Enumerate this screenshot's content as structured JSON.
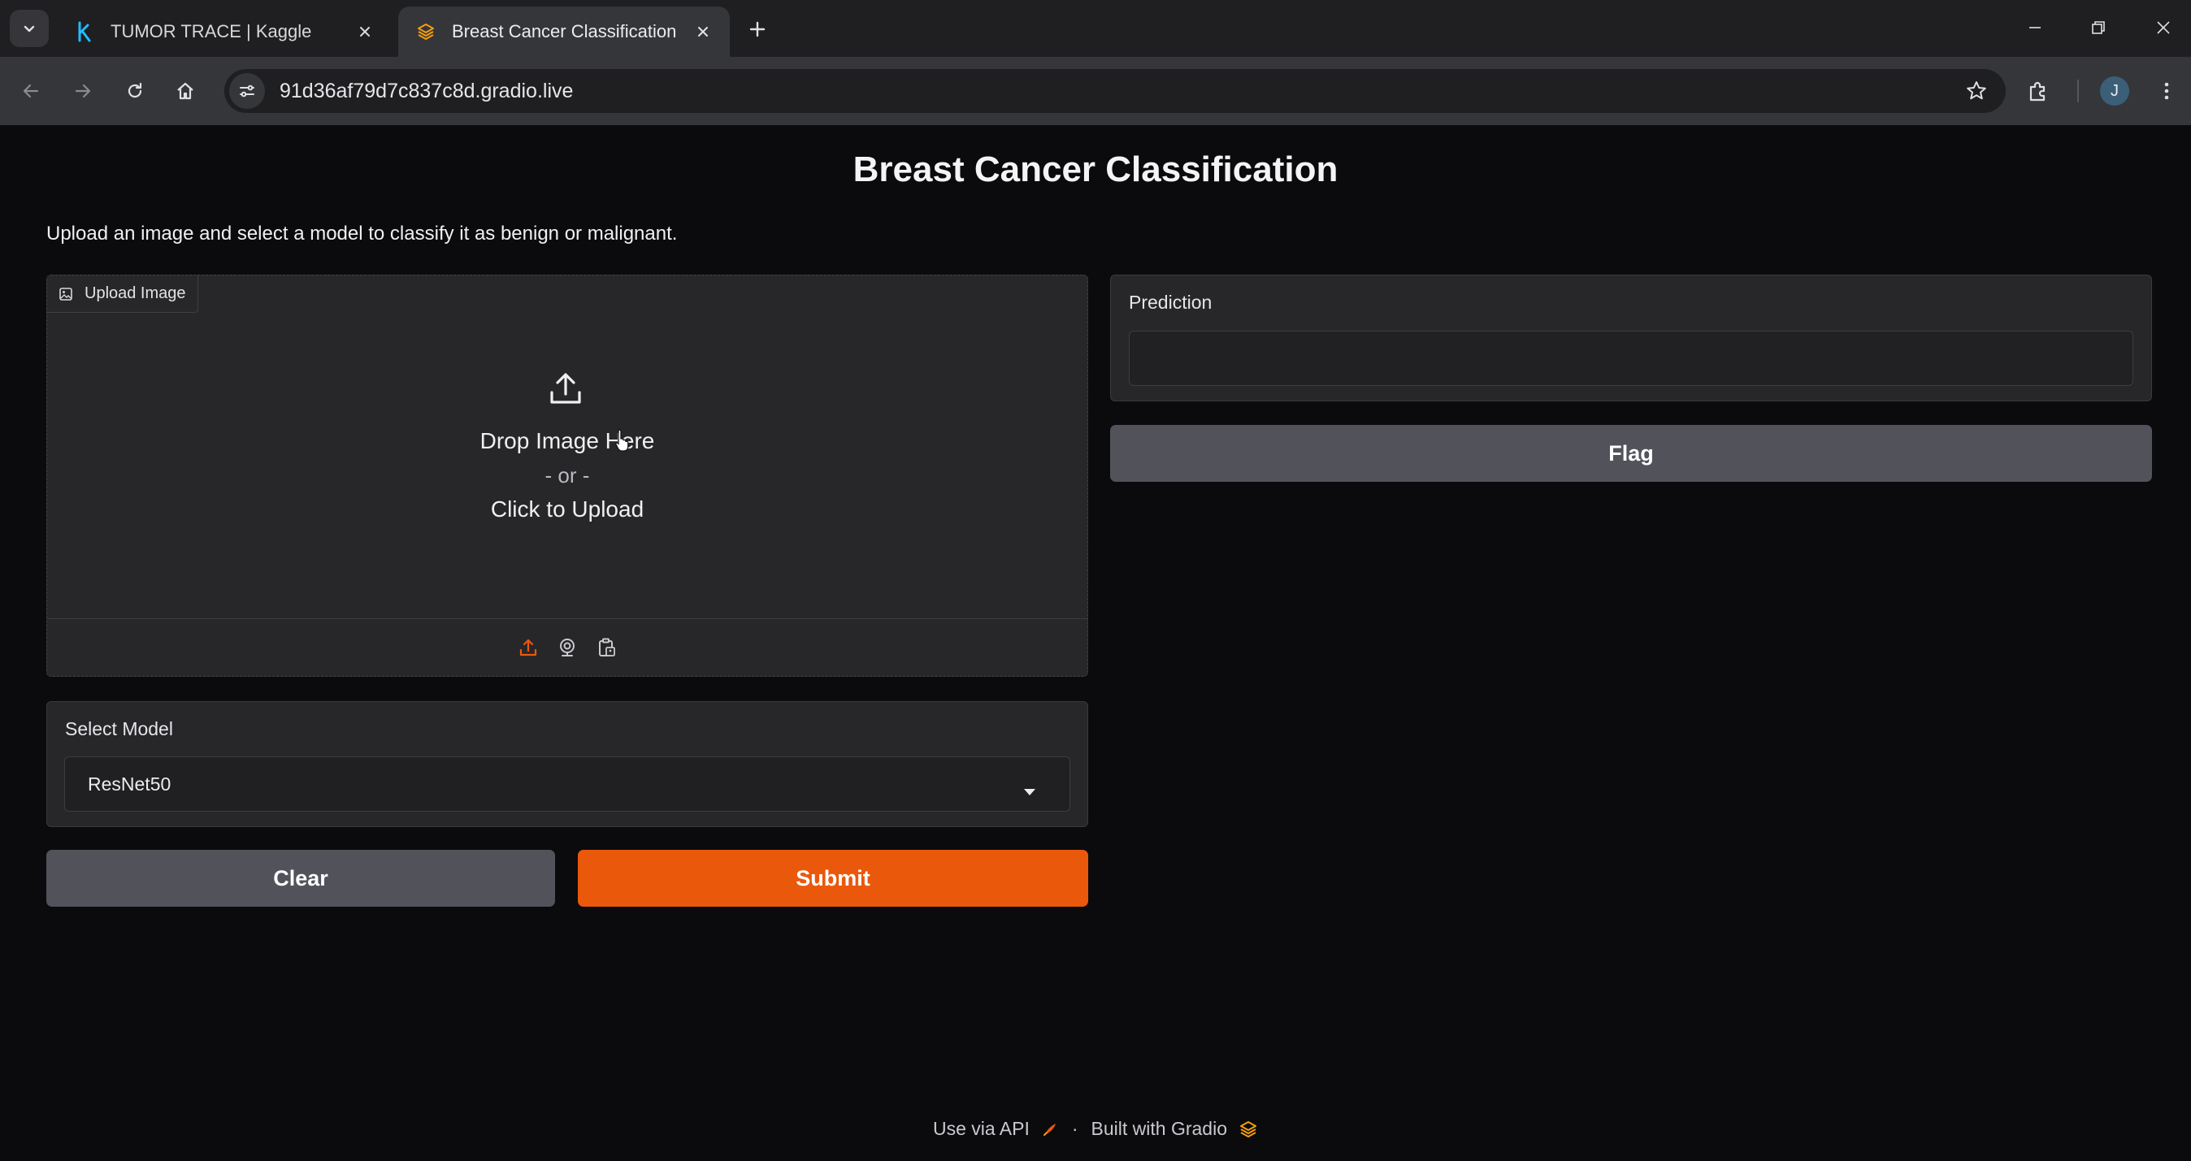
{
  "browser": {
    "tabs": [
      {
        "title": "TUMOR TRACE | Kaggle",
        "favicon": "kaggle-k-icon",
        "active": false
      },
      {
        "title": "Breast Cancer Classification",
        "favicon": "gradio-icon",
        "active": true
      }
    ],
    "url": "91d36af79d7c837c8d.gradio.live",
    "profile_initial": "J"
  },
  "app": {
    "title": "Breast Cancer Classification",
    "description": "Upload an image and select a model to classify it as benign or malignant.",
    "upload": {
      "label": "Upload Image",
      "drop_text": "Drop Image Here",
      "or_text": "- or -",
      "click_text": "Click to Upload",
      "sources": [
        "upload-icon",
        "webcam-icon",
        "clipboard-icon"
      ]
    },
    "model": {
      "label": "Select Model",
      "selected": "ResNet50"
    },
    "buttons": {
      "clear": "Clear",
      "submit": "Submit",
      "flag": "Flag"
    },
    "prediction": {
      "label": "Prediction",
      "value": ""
    },
    "footer": {
      "api_text": "Use via API",
      "separator": "·",
      "built_text": "Built with Gradio"
    }
  },
  "colors": {
    "accent": "#ea580c",
    "secondary_button": "#52525b",
    "panel": "#27272a",
    "background": "#0b0b0e"
  }
}
